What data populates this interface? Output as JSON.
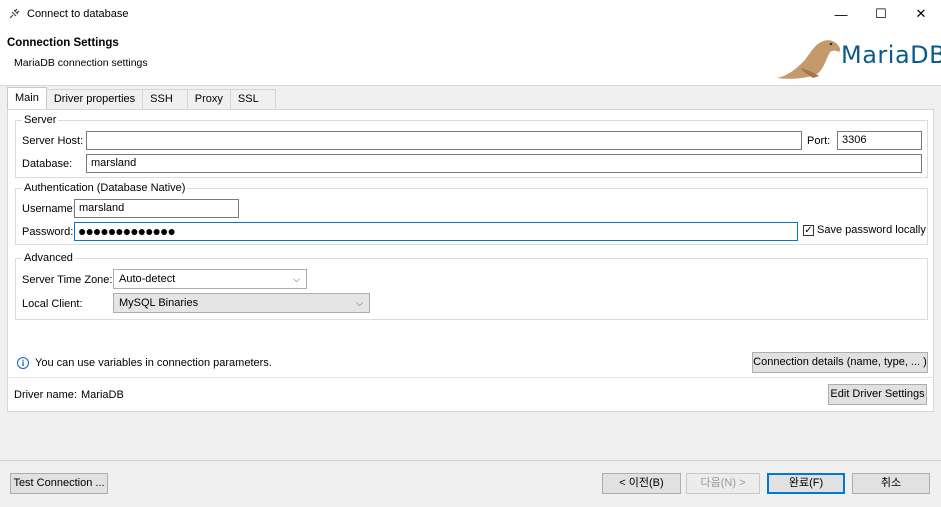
{
  "window": {
    "title": "Connect to database",
    "minimize_glyph": "—",
    "maximize_glyph": "☐",
    "close_glyph": "✕"
  },
  "header": {
    "title": "Connection Settings",
    "subtitle": "MariaDB connection settings",
    "logo_text": "MariaDB",
    "logo_color": "#0a5b8a",
    "seal_color": "#c49a6c"
  },
  "tabs": [
    {
      "label": "Main",
      "active": true
    },
    {
      "label": "Driver properties",
      "active": false
    },
    {
      "label": "SSH",
      "active": false
    },
    {
      "label": "Proxy",
      "active": false
    },
    {
      "label": "SSL",
      "active": false
    }
  ],
  "server": {
    "legend": "Server",
    "host_label": "Server Host:",
    "host_value": "",
    "port_label": "Port:",
    "port_value": "3306",
    "database_label": "Database:",
    "database_value": "marsland"
  },
  "auth": {
    "legend": "Authentication (Database Native)",
    "username_label": "Username:",
    "username_value": "marsland",
    "password_label": "Password:",
    "password_value": "●●●●●●●●●●●●●",
    "save_password_label": "Save password locally",
    "save_password_checked": true,
    "check_glyph": "✓"
  },
  "advanced": {
    "legend": "Advanced",
    "timezone_label": "Server Time Zone:",
    "timezone_value": "Auto-detect",
    "client_label": "Local Client:",
    "client_value": "MySQL Binaries",
    "dropdown_glyph": "⌵"
  },
  "info": {
    "icon_glyph": "i",
    "text": "You can use variables in connection parameters.",
    "details_button": "Connection details (name, type, ... )"
  },
  "driver": {
    "label": "Driver name:",
    "value": "MariaDB",
    "edit_button": "Edit Driver Settings"
  },
  "footer": {
    "test_button": "Test Connection ...",
    "back_button": "< 이전(B)",
    "next_button": "다음(N) >",
    "finish_button": "완료(F)",
    "cancel_button": "취소"
  }
}
